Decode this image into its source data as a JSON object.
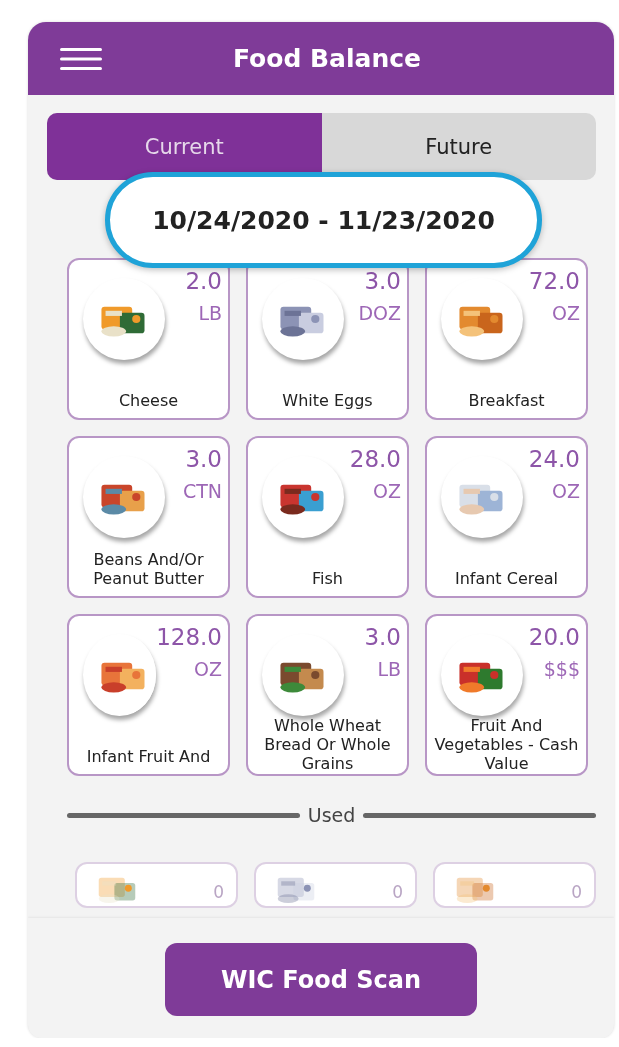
{
  "header": {
    "title": "Food Balance"
  },
  "tabs": [
    {
      "label": "Current",
      "selected": true
    },
    {
      "label": "Future",
      "selected": false
    }
  ],
  "period": "10/24/2020 - 11/23/2020",
  "balances": [
    {
      "name": "Cheese",
      "amount": "2.0",
      "unit": "LB"
    },
    {
      "name": "White Eggs",
      "amount": "3.0",
      "unit": "DOZ"
    },
    {
      "name": "Breakfast",
      "amount": "72.0",
      "unit": "OZ"
    },
    {
      "name": "Beans And/Or Peanut Butter",
      "amount": "3.0",
      "unit": "CTN"
    },
    {
      "name": "Fish",
      "amount": "28.0",
      "unit": "OZ"
    },
    {
      "name": "Infant Cereal",
      "amount": "24.0",
      "unit": "OZ"
    },
    {
      "name": "Infant Fruit And",
      "amount": "128.0",
      "unit": "OZ"
    },
    {
      "name": "Whole Wheat Bread Or Whole Grains",
      "amount": "3.0",
      "unit": "LB"
    },
    {
      "name": "Fruit And Vegetables - Cash Value",
      "amount": "20.0",
      "unit": "$$$"
    }
  ],
  "used_heading": "Used",
  "used": [
    {
      "amount": "0"
    },
    {
      "amount": "0"
    },
    {
      "amount": "0"
    }
  ],
  "scan_button": "WIC Food Scan"
}
